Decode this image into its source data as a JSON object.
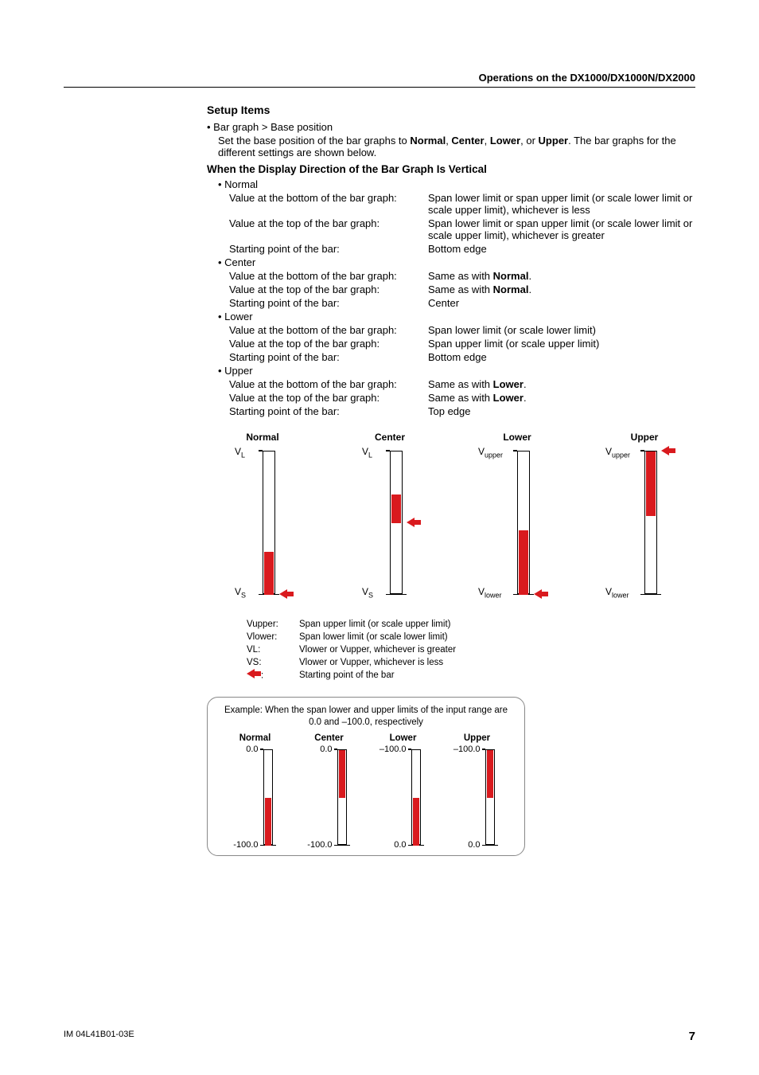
{
  "header": {
    "title": "Operations on the DX1000/DX1000N/DX2000"
  },
  "footer": {
    "doc_id": "IM 04L41B01-03E",
    "page": "7"
  },
  "section": {
    "title": "Setup Items",
    "item_label": "Bar graph > Base position",
    "item_desc_1": "Set the base position of the bar graphs to ",
    "opt_normal": "Normal",
    "opt_center": "Center",
    "opt_lower": "Lower",
    "opt_upper": "Upper",
    "item_desc_2": ". The bar graphs for the different settings are shown below.",
    "sep_comma": ", ",
    "sep_or": ", or ",
    "subheading": "When the Display Direction of the Bar Graph Is Vertical",
    "modes": {
      "normal": {
        "label": "Normal",
        "r1k": "Value at the bottom of the bar graph:",
        "r1v": "Span lower limit or span upper limit (or scale lower limit or scale upper limit), whichever is less",
        "r2k": "Value at the top of the bar graph:",
        "r2v": "Span lower limit or span upper limit (or scale lower limit or scale upper limit), whichever is greater",
        "r3k": "Starting point of the bar:",
        "r3v": "Bottom edge"
      },
      "center": {
        "label": "Center",
        "r1k": "Value at the bottom of the bar graph:",
        "r1v_pre": "Same as with ",
        "r1v_bold": "Normal",
        "r1v_post": ".",
        "r2k": "Value at the top of the bar graph:",
        "r2v_pre": "Same as with ",
        "r2v_bold": "Normal",
        "r2v_post": ".",
        "r3k": "Starting point of the bar:",
        "r3v": "Center"
      },
      "lower": {
        "label": "Lower",
        "r1k": "Value at the bottom of the bar graph:",
        "r1v": "Span lower limit (or scale lower limit)",
        "r2k": "Value at the top of the bar graph:",
        "r2v": "Span upper limit (or scale upper limit)",
        "r3k": "Starting point of the bar:",
        "r3v": "Bottom edge"
      },
      "upper": {
        "label": "Upper",
        "r1k": "Value at the bottom of the bar graph:",
        "r1v_pre": "Same as with ",
        "r1v_bold": "Lower",
        "r1v_post": ".",
        "r2k": "Value at the top of the bar graph:",
        "r2v_pre": "Same as with ",
        "r2v_bold": "Lower",
        "r2v_post": ".",
        "r3k": "Starting point of the bar:",
        "r3v": "Top edge"
      }
    }
  },
  "chart_data": [
    {
      "type": "bar",
      "title": "Normal",
      "top_label": "V_L",
      "bottom_label": "V_S",
      "fill_from_pct": 100,
      "fill_to_pct": 70,
      "arrow_at_pct": 100
    },
    {
      "type": "bar",
      "title": "Center",
      "top_label": "V_L",
      "bottom_label": "V_S",
      "fill_from_pct": 50,
      "fill_to_pct": 30,
      "arrow_at_pct": 50
    },
    {
      "type": "bar",
      "title": "Lower",
      "top_label": "V_upper",
      "bottom_label": "V_lower",
      "fill_from_pct": 100,
      "fill_to_pct": 55,
      "arrow_at_pct": 100
    },
    {
      "type": "bar",
      "title": "Upper",
      "top_label": "V_upper",
      "bottom_label": "V_lower",
      "fill_from_pct": 0,
      "fill_to_pct": 45,
      "arrow_at_pct": 0
    }
  ],
  "legend": {
    "rows": [
      {
        "k": "Vupper:",
        "v": "Span upper limit (or scale upper limit)"
      },
      {
        "k": "Vlower:",
        "v": "Span lower limit (or scale lower limit)"
      },
      {
        "k": "VL:",
        "v": "Vlower or Vupper, whichever is greater"
      },
      {
        "k": "VS:",
        "v": "Vlower or Vupper, whichever is less"
      }
    ],
    "arrow_label": ":",
    "arrow_desc": "Starting point of the bar"
  },
  "example": {
    "title": "Example: When the span lower and upper limits of the input range are 0.0 and –100.0, respectively",
    "cols": [
      {
        "title": "Normal",
        "top": "0.0",
        "bottom": "-100.0",
        "fill_from_pct": 100,
        "fill_to_pct": 50
      },
      {
        "title": "Center",
        "top": "0.0",
        "bottom": "-100.0",
        "fill_from_pct": 50,
        "fill_to_pct": 0
      },
      {
        "title": "Lower",
        "top": "–100.0",
        "bottom": "0.0",
        "fill_from_pct": 100,
        "fill_to_pct": 50
      },
      {
        "title": "Upper",
        "top": "–100.0",
        "bottom": "0.0",
        "fill_from_pct": 0,
        "fill_to_pct": 50
      }
    ]
  }
}
